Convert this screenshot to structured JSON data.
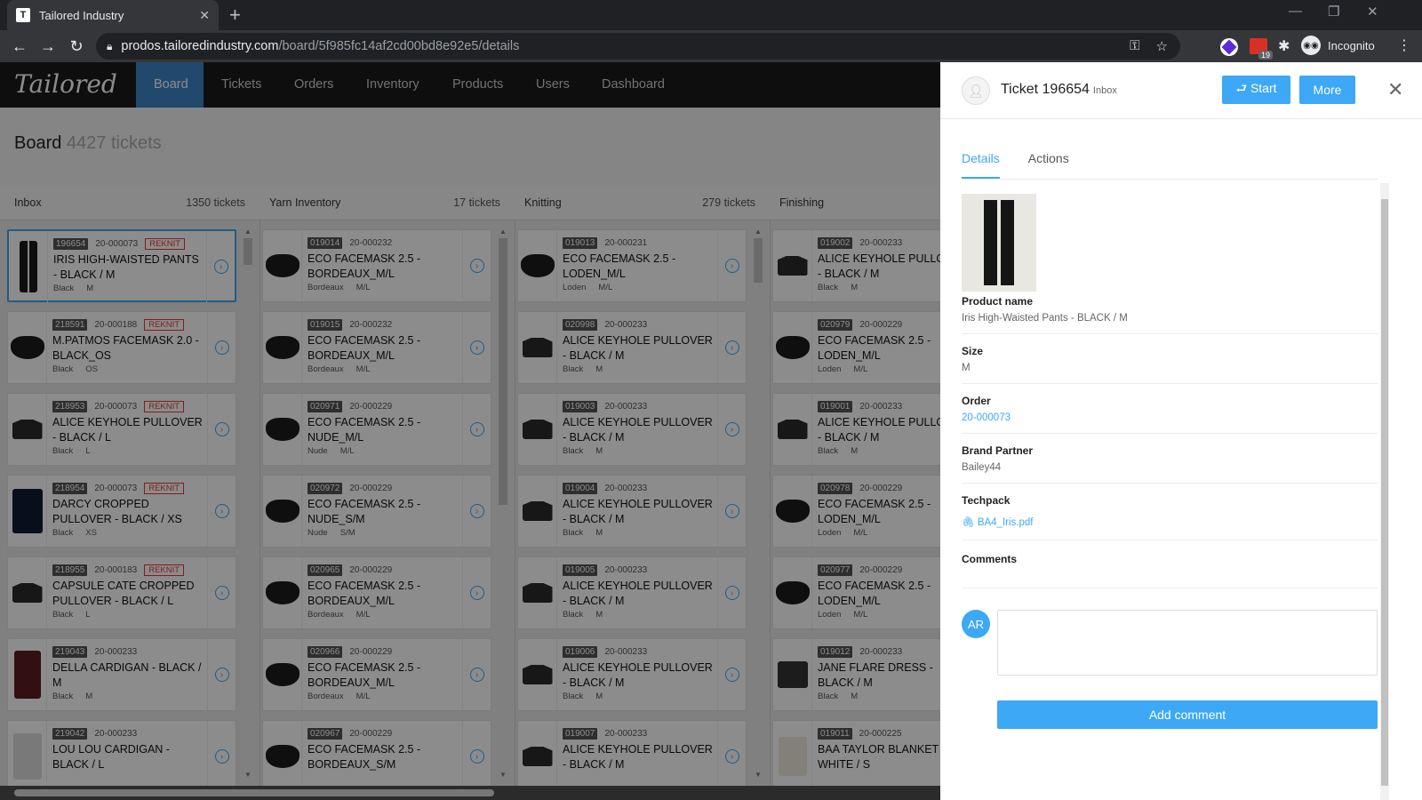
{
  "browser": {
    "tab_title": "Tailored Industry",
    "url_host": "prodos.tailoredindustry.com",
    "url_path": "/board/5f985fc14af2cd00bd8e92e5/details",
    "incognito_label": "Incognito",
    "ext_badge": "19"
  },
  "app": {
    "logo": "Tailored",
    "nav": [
      "Board",
      "Tickets",
      "Orders",
      "Inventory",
      "Products",
      "Users",
      "Dashboard"
    ],
    "board_title": "Board",
    "board_count": "4427 tickets"
  },
  "columns": [
    {
      "name": "Inbox",
      "count": "1350 tickets",
      "cards": [
        {
          "id": "196654",
          "order": "20-000073",
          "tag": "REKNIT",
          "name": "IRIS HIGH-WAISTED PANTS - BLACK / M",
          "color": "Black",
          "size": "M",
          "img": "pants",
          "selected": true
        },
        {
          "id": "218591",
          "order": "20-000188",
          "tag": "REKNIT",
          "name": "M.PATMOS FACEMASK 2.0 - BLACK_OS",
          "color": "Black",
          "size": "OS",
          "img": "mask"
        },
        {
          "id": "218953",
          "order": "20-000073",
          "tag": "REKNIT",
          "name": "ALICE KEYHOLE PULLOVER - BLACK / L",
          "color": "Black",
          "size": "L",
          "img": "top"
        },
        {
          "id": "218954",
          "order": "20-000073",
          "tag": "REKNIT",
          "name": "DARCY CROPPED PULLOVER - BLACK / XS",
          "color": "Black",
          "size": "XS",
          "img": "sweater"
        },
        {
          "id": "218955",
          "order": "20-000183",
          "tag": "REKNIT",
          "name": "CAPSULE CATE CROPPED PULLOVER - BLACK / L",
          "color": "Black",
          "size": "L",
          "img": "top"
        },
        {
          "id": "219043",
          "order": "20-000233",
          "tag": "",
          "name": "DELLA CARDIGAN - BLACK / M",
          "color": "Black",
          "size": "M",
          "img": "cardigan"
        },
        {
          "id": "219042",
          "order": "20-000233",
          "tag": "",
          "name": "LOU LOU CARDIGAN - BLACK / L",
          "color": "",
          "size": "",
          "img": "light"
        }
      ]
    },
    {
      "name": "Yarn Inventory",
      "count": "17 tickets",
      "cards": [
        {
          "id": "019014",
          "order": "20-000232",
          "tag": "",
          "name": "ECO FACEMASK 2.5 - BORDEAUX_M/L",
          "color": "Bordeaux",
          "size": "M/L",
          "img": "mask"
        },
        {
          "id": "019015",
          "order": "20-000232",
          "tag": "",
          "name": "ECO FACEMASK 2.5 - BORDEAUX_M/L",
          "color": "Bordeaux",
          "size": "M/L",
          "img": "mask"
        },
        {
          "id": "020971",
          "order": "20-000229",
          "tag": "",
          "name": "ECO FACEMASK 2.5 - NUDE_M/L",
          "color": "Nude",
          "size": "M/L",
          "img": "mask"
        },
        {
          "id": "020972",
          "order": "20-000229",
          "tag": "",
          "name": "ECO FACEMASK 2.5 - NUDE_S/M",
          "color": "Nude",
          "size": "S/M",
          "img": "mask"
        },
        {
          "id": "020965",
          "order": "20-000229",
          "tag": "",
          "name": "ECO FACEMASK 2.5 - BORDEAUX_M/L",
          "color": "Bordeaux",
          "size": "M/L",
          "img": "mask"
        },
        {
          "id": "020966",
          "order": "20-000229",
          "tag": "",
          "name": "ECO FACEMASK 2.5 - BORDEAUX_M/L",
          "color": "Bordeaux",
          "size": "M/L",
          "img": "mask"
        },
        {
          "id": "020967",
          "order": "20-000229",
          "tag": "",
          "name": "ECO FACEMASK 2.5 - BORDEAUX_S/M",
          "color": "",
          "size": "",
          "img": "mask"
        }
      ]
    },
    {
      "name": "Knitting",
      "count": "279 tickets",
      "cards": [
        {
          "id": "019013",
          "order": "20-000231",
          "tag": "",
          "name": "ECO FACEMASK 2.5 - LODEN_M/L",
          "color": "Loden",
          "size": "M/L",
          "img": "mask"
        },
        {
          "id": "020998",
          "order": "20-000233",
          "tag": "",
          "name": "ALICE KEYHOLE PULLOVER - BLACK / M",
          "color": "Black",
          "size": "M",
          "img": "top"
        },
        {
          "id": "019003",
          "order": "20-000233",
          "tag": "",
          "name": "ALICE KEYHOLE PULLOVER - BLACK / M",
          "color": "Black",
          "size": "M",
          "img": "top"
        },
        {
          "id": "019004",
          "order": "20-000233",
          "tag": "",
          "name": "ALICE KEYHOLE PULLOVER - BLACK / M",
          "color": "Black",
          "size": "M",
          "img": "top"
        },
        {
          "id": "019005",
          "order": "20-000233",
          "tag": "",
          "name": "ALICE KEYHOLE PULLOVER - BLACK / M",
          "color": "Black",
          "size": "M",
          "img": "top"
        },
        {
          "id": "019006",
          "order": "20-000233",
          "tag": "",
          "name": "ALICE KEYHOLE PULLOVER - BLACK / M",
          "color": "Black",
          "size": "M",
          "img": "top"
        },
        {
          "id": "019007",
          "order": "20-000233",
          "tag": "",
          "name": "ALICE KEYHOLE PULLOVER - BLACK / M",
          "color": "",
          "size": "",
          "img": "top"
        }
      ]
    },
    {
      "name": "Finishing",
      "count": "",
      "cards": [
        {
          "id": "019002",
          "order": "20-000233",
          "tag": "",
          "name": "ALICE KEYHOLE PULLOVER - BLACK / M",
          "color": "Black",
          "size": "M",
          "img": "top"
        },
        {
          "id": "020979",
          "order": "20-000229",
          "tag": "",
          "name": "ECO FACEMASK 2.5 - LODEN_M/L",
          "color": "Loden",
          "size": "M/L",
          "img": "mask"
        },
        {
          "id": "019001",
          "order": "20-000233",
          "tag": "",
          "name": "ALICE KEYHOLE PULLOVER - BLACK / M",
          "color": "Black",
          "size": "M",
          "img": "top"
        },
        {
          "id": "020978",
          "order": "20-000229",
          "tag": "",
          "name": "ECO FACEMASK 2.5 - LODEN_M/L",
          "color": "Loden",
          "size": "M/L",
          "img": "mask"
        },
        {
          "id": "020977",
          "order": "20-000229",
          "tag": "",
          "name": "ECO FACEMASK 2.5 - LODEN_M/L",
          "color": "Loden",
          "size": "M/L",
          "img": "mask"
        },
        {
          "id": "019012",
          "order": "20-000233",
          "tag": "",
          "name": "JANE FLARE DRESS - BLACK / M",
          "color": "Black",
          "size": "M",
          "img": "dress"
        },
        {
          "id": "019011",
          "order": "20-000225",
          "tag": "",
          "name": "BAA TAYLOR BLANKET - WHITE / S",
          "color": "",
          "size": "",
          "img": "blank"
        }
      ]
    }
  ],
  "panel": {
    "ticket_title": "Ticket 196654",
    "ticket_status": "Inbox",
    "start_label": "⮐ Start",
    "more_label": "More",
    "tabs": [
      "Details",
      "Actions"
    ],
    "product_name_label": "Product name",
    "product_name": "Iris High-Waisted Pants - BLACK / M",
    "size_label": "Size",
    "size": "M",
    "order_label": "Order",
    "order": "20-000073",
    "brand_label": "Brand Partner",
    "brand": "Bailey44",
    "techpack_label": "Techpack",
    "techpack_file": "BA4_Iris.pdf",
    "comments_label": "Comments",
    "comment_avatar": "AR",
    "add_comment_label": "Add comment"
  },
  "colors": {
    "accent": "#3da8f5",
    "nav_bg": "#1b1b1b",
    "reknit": "#e53935"
  }
}
